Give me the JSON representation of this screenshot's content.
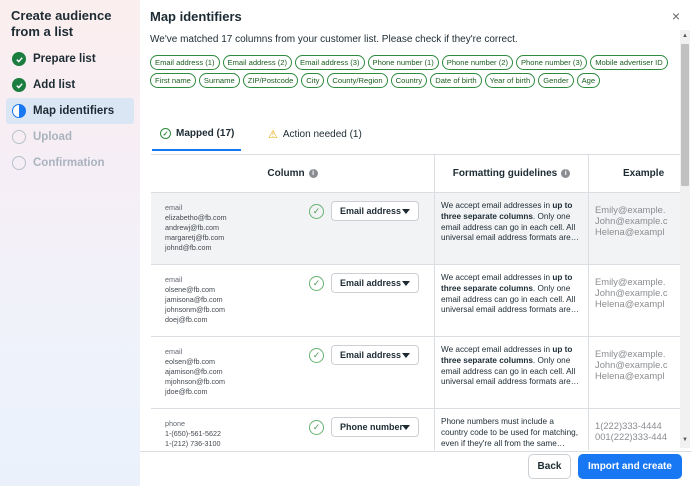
{
  "sidebar": {
    "title": "Create audience from a list",
    "steps": [
      {
        "label": "Prepare list",
        "state": "done"
      },
      {
        "label": "Add list",
        "state": "done"
      },
      {
        "label": "Map identifiers",
        "state": "active"
      },
      {
        "label": "Upload",
        "state": "pending"
      },
      {
        "label": "Confirmation",
        "state": "pending"
      }
    ]
  },
  "header": {
    "title": "Map identifiers",
    "close_icon": "×",
    "subtitle": "We've matched 17 columns from your customer list. Please check if they're correct."
  },
  "identifiers": [
    "Email address (1)",
    "Email address (2)",
    "Email address (3)",
    "Phone number (1)",
    "Phone number (2)",
    "Phone number (3)",
    "Mobile advertiser ID",
    "First name",
    "Surname",
    "ZIP/Postcode",
    "City",
    "County/Region",
    "Country",
    "Date of birth",
    "Year of birth",
    "Gender",
    "Age"
  ],
  "tabs": {
    "mapped": "Mapped (17)",
    "action": "Action needed (1)"
  },
  "table": {
    "headers": {
      "column": "Column",
      "guidelines": "Formatting guidelines",
      "example": "Example"
    },
    "rows": [
      {
        "samples": [
          "email",
          "elizabetho@fb.com",
          "andrewj@fb.com",
          "margaretj@fb.com",
          "johnd@fb.com"
        ],
        "mapping": "Email address",
        "guide_pre": "We accept email addresses in ",
        "guide_bold": "up to three separate columns",
        "guide_post": ". Only one email address can go in each cell. All universal email address formats are…",
        "examples": [
          "Emily@example.",
          "John@example.c",
          "Helena@exampl"
        ]
      },
      {
        "samples": [
          "email",
          "olsene@fb.com",
          "jamisona@fb.com",
          "johnsonm@fb.com",
          "doej@fb.com"
        ],
        "mapping": "Email address",
        "guide_pre": "We accept email addresses in ",
        "guide_bold": "up to three separate columns",
        "guide_post": ". Only one email address can go in each cell. All universal email address formats are…",
        "examples": [
          "Emily@example.",
          "John@example.c",
          "Helena@exampl"
        ]
      },
      {
        "samples": [
          "email",
          "eolsen@fb.com",
          "ajamison@fb.com",
          "mjohnson@fb.com",
          "jdoe@fb.com"
        ],
        "mapping": "Email address",
        "guide_pre": "We accept email addresses in ",
        "guide_bold": "up to three separate columns",
        "guide_post": ". Only one email address can go in each cell. All universal email address formats are…",
        "examples": [
          "Emily@example.",
          "John@example.c",
          "Helena@exampl"
        ]
      },
      {
        "samples": [
          "phone",
          "1-(650)-561-5622",
          "1-(212) 736-3100"
        ],
        "mapping": "Phone number",
        "guide_pre": "Phone numbers must include a country code to be used for matching, even if they're all from the same…",
        "guide_bold": "",
        "guide_post": "",
        "examples": [
          "1(222)333-4444",
          "001(222)333-444"
        ]
      }
    ]
  },
  "footer": {
    "back": "Back",
    "import": "Import and create"
  },
  "colors": {
    "accent": "#1877f2",
    "success": "#1b7d3f"
  }
}
